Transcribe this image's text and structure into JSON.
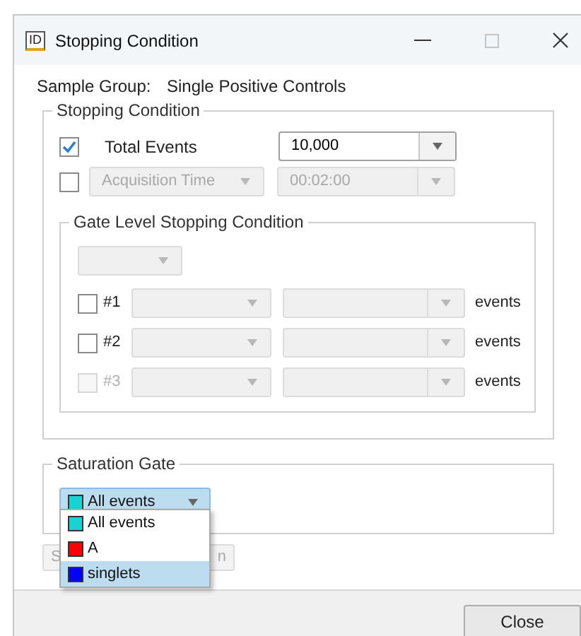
{
  "window": {
    "icon_text": "ID",
    "title": "Stopping Condition",
    "maximize_disabled": true
  },
  "sample_group": {
    "label": "Sample Group:",
    "value": "Single Positive Controls"
  },
  "stopping_condition": {
    "title": "Stopping Condition",
    "total_events": {
      "checked": true,
      "label": "Total Events",
      "value": "10,000"
    },
    "acquisition_time": {
      "checked": false,
      "disabled": true,
      "selector": "Acquisition Time",
      "value": "00:02:00"
    }
  },
  "gate_level": {
    "title": "Gate Level Stopping Condition",
    "rows": [
      {
        "label": "#1",
        "checked": false,
        "disabled": false,
        "unit": "events"
      },
      {
        "label": "#2",
        "checked": false,
        "disabled": false,
        "unit": "events"
      },
      {
        "label": "#3",
        "checked": false,
        "disabled": true,
        "unit": "events"
      }
    ]
  },
  "saturation_gate": {
    "title": "Saturation Gate",
    "current": {
      "label": "All events",
      "color": "#19d3d3"
    },
    "options": [
      {
        "label": "All events",
        "color": "#19d3d3",
        "selected": false
      },
      {
        "label": "A",
        "color": "#ff0000",
        "selected": false
      },
      {
        "label": "singlets",
        "color": "#0000ff",
        "selected": true
      }
    ]
  },
  "covered_button": {
    "left_text": "S",
    "right_text": "n"
  },
  "buttons": [
    {
      "label": "Close"
    }
  ]
}
